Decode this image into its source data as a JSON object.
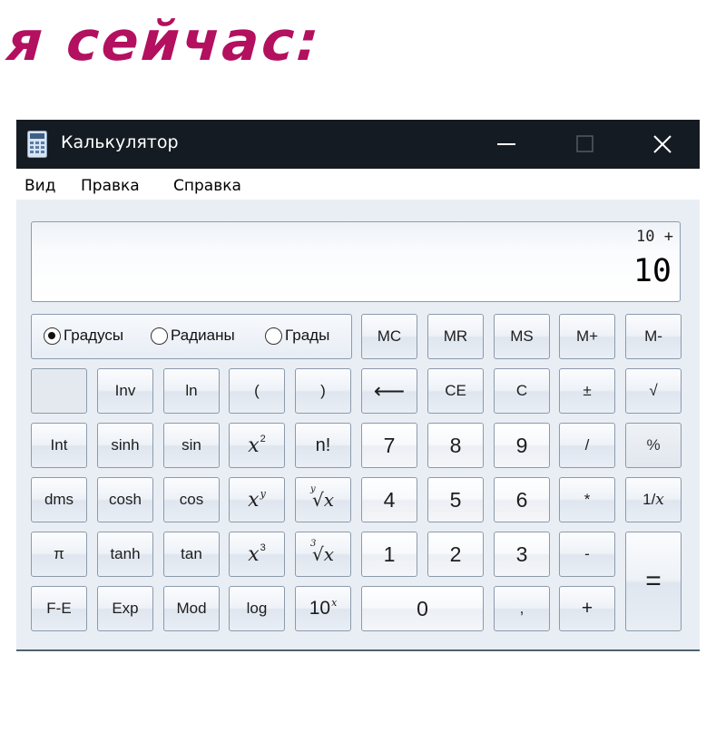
{
  "caption": "я сейчас:",
  "window": {
    "title": "Калькулятор",
    "icon": "calculator-icon"
  },
  "menu": [
    "Вид",
    "Правка",
    "Справка"
  ],
  "display": {
    "expression": "10 +",
    "value": "10"
  },
  "angle_modes": {
    "options": [
      "Градусы",
      "Радианы",
      "Грады"
    ],
    "selected": "Градусы"
  },
  "keys": {
    "mc": "MC",
    "mr": "MR",
    "ms": "MS",
    "mplus": "M+",
    "mminus": "M-",
    "inv": "Inv",
    "ln": "ln",
    "lparen": "(",
    "rparen": ")",
    "backspace": "⟵",
    "ce": "CE",
    "c": "C",
    "plusminus": "±",
    "sqrt": "√",
    "int": "Int",
    "sinh": "sinh",
    "sin": "sin",
    "x2_base": "x",
    "x2_exp": "2",
    "fact": "n!",
    "d7": "7",
    "d8": "8",
    "d9": "9",
    "div": "/",
    "pct": "%",
    "dms": "dms",
    "cosh": "cosh",
    "cos": "cos",
    "xy_base": "x",
    "xy_exp": "y",
    "yroot_index": "y",
    "yroot_body": "√x",
    "d4": "4",
    "d5": "5",
    "d6": "6",
    "mul": "*",
    "recip_prefix": "1/",
    "recip_var": "x",
    "pi": "π",
    "tanh": "tanh",
    "tan": "tan",
    "x3_base": "x",
    "x3_exp": "3",
    "root3_index": "3",
    "root3_body": "√x",
    "d1": "1",
    "d2": "2",
    "d3": "3",
    "minus": "-",
    "eq": "=",
    "fe": "F-E",
    "exp": "Exp",
    "mod": "Mod",
    "log": "log",
    "tenx_base": "10",
    "tenx_exp": "x",
    "d0": "0",
    "dot": ",",
    "plus": "+"
  }
}
